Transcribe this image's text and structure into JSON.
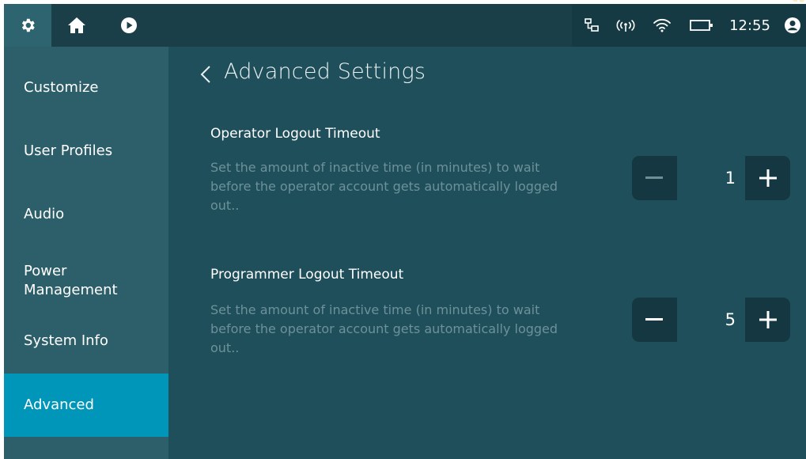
{
  "topbar": {
    "icons": [
      "gear-icon",
      "home-icon",
      "play-icon"
    ],
    "status_icons": [
      "network-icon",
      "antenna-icon",
      "wifi-icon",
      "battery-icon",
      "account-icon"
    ],
    "clock": "12:55"
  },
  "sidebar": {
    "items": [
      {
        "label": "Customize",
        "active": false
      },
      {
        "label": "User Profiles",
        "active": false
      },
      {
        "label": "Audio",
        "active": false
      },
      {
        "label": "Power\nManagement",
        "active": false
      },
      {
        "label": "System Info",
        "active": false
      },
      {
        "label": "Advanced",
        "active": true
      }
    ]
  },
  "main": {
    "title": "Advanced Settings",
    "sections": [
      {
        "title": "Operator Logout Timeout",
        "description": "Set the amount of inactive time (in minutes) to wait before the operator account gets automatically logged out..",
        "value": "1"
      },
      {
        "title": "Programmer Logout Timeout",
        "description": "Set the amount of inactive time (in minutes) to wait before the operator account gets automatically logged out..",
        "value": "5"
      }
    ]
  },
  "colors": {
    "topbar": "#1b3f49",
    "sidebar": "#2d5f6b",
    "active_item": "#0096b9",
    "main_bg": "#1f4f5b",
    "stepper_bg": "#143741",
    "muted_text": "#6d9199"
  }
}
